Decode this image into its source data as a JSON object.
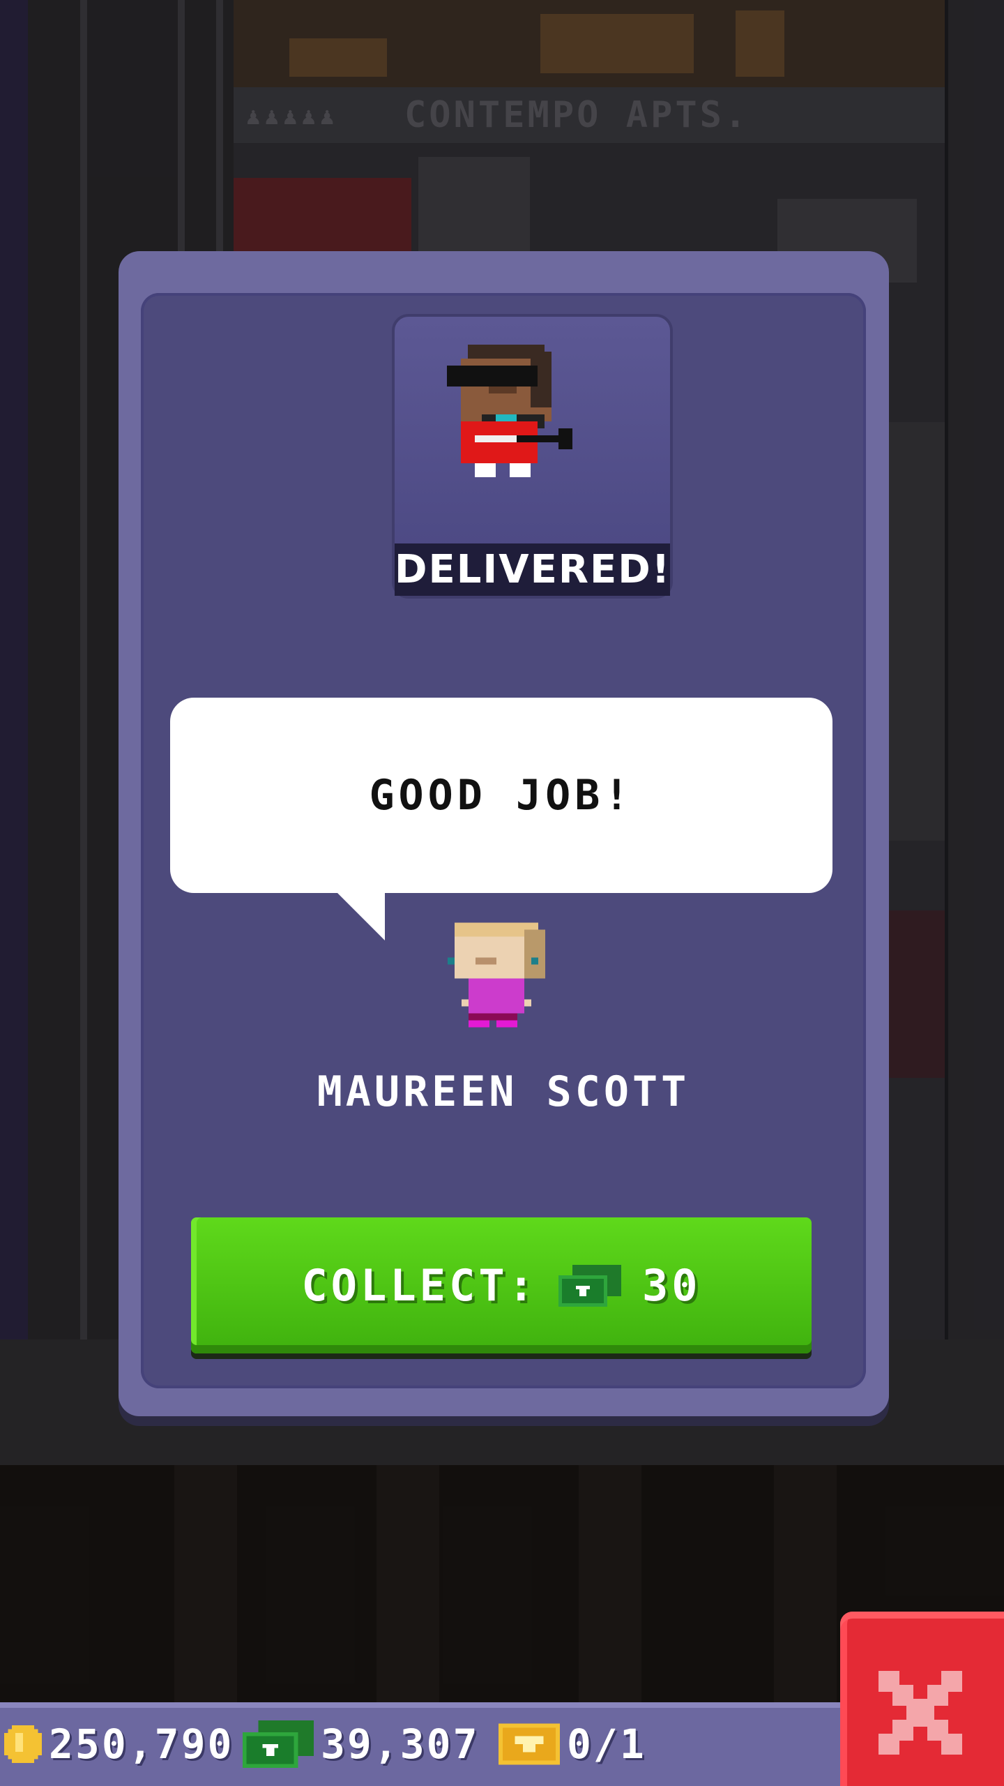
{
  "scene": {
    "building_sign": "CONTEMPO APTS."
  },
  "delivery_dialog": {
    "status": "DELIVERED!",
    "speech": "GOOD JOB!",
    "recipient_name": "MAUREEN SCOTT",
    "collect_label": "COLLECT:",
    "collect_amount": "30",
    "collect_currency_icon": "tower-bux-icon"
  },
  "hud": {
    "coins": "250,790",
    "bux": "39,307",
    "tickets": "0/1",
    "icons": [
      "coin-icon",
      "tower-bux-icon",
      "golden-ticket-icon"
    ]
  },
  "close_button_icon": "close-icon",
  "colors": {
    "dialog_frame": "#6e6a9f",
    "dialog_body": "#4d4a7c",
    "collect_button": "#4fc614",
    "close_button": "#e42a35"
  }
}
